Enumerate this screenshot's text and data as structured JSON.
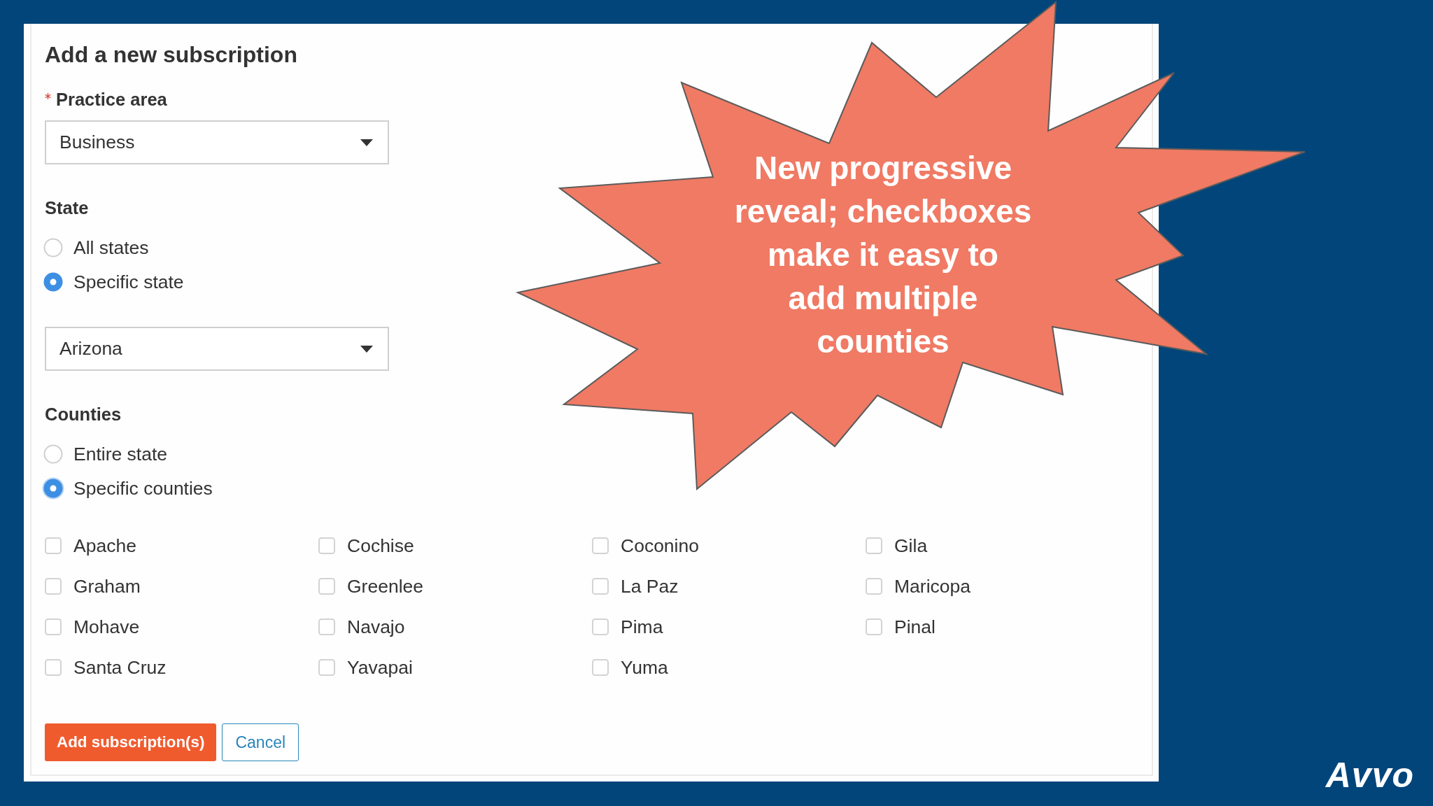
{
  "form": {
    "title": "Add a new subscription",
    "fields": [
      {
        "kind": "select",
        "label": "Practice area",
        "required": true,
        "value": "Business"
      },
      {
        "kind": "radio",
        "label": "State",
        "options": [
          {
            "label": "All states",
            "selected": false,
            "focused": false
          },
          {
            "label": "Specific state",
            "selected": true,
            "focused": false
          }
        ]
      },
      {
        "kind": "select",
        "value": "Arizona"
      },
      {
        "kind": "radio",
        "label": "Counties",
        "options": [
          {
            "label": "Entire state",
            "selected": false,
            "focused": false
          },
          {
            "label": "Specific counties",
            "selected": true,
            "focused": true
          }
        ]
      },
      {
        "kind": "checkbox_grid",
        "options": [
          {
            "label": "Apache",
            "checked": false
          },
          {
            "label": "Cochise",
            "checked": false
          },
          {
            "label": "Coconino",
            "checked": false
          },
          {
            "label": "Gila",
            "checked": false
          },
          {
            "label": "Graham",
            "checked": false
          },
          {
            "label": "Greenlee",
            "checked": false
          },
          {
            "label": "La Paz",
            "checked": false
          },
          {
            "label": "Maricopa",
            "checked": false
          },
          {
            "label": "Mohave",
            "checked": false
          },
          {
            "label": "Navajo",
            "checked": false
          },
          {
            "label": "Pima",
            "checked": false
          },
          {
            "label": "Pinal",
            "checked": false
          },
          {
            "label": "Santa Cruz",
            "checked": false
          },
          {
            "label": "Yavapai",
            "checked": false
          },
          {
            "label": "Yuma",
            "checked": false
          }
        ]
      }
    ],
    "buttons": [
      {
        "label": "Add subscription(s)",
        "kind": "primary"
      },
      {
        "label": "Cancel",
        "kind": "secondary"
      }
    ]
  },
  "callout": {
    "text": "New progressive\nreveal; checkboxes\nmake it easy to\nadd multiple\ncounties"
  },
  "logo": "Avvo"
}
